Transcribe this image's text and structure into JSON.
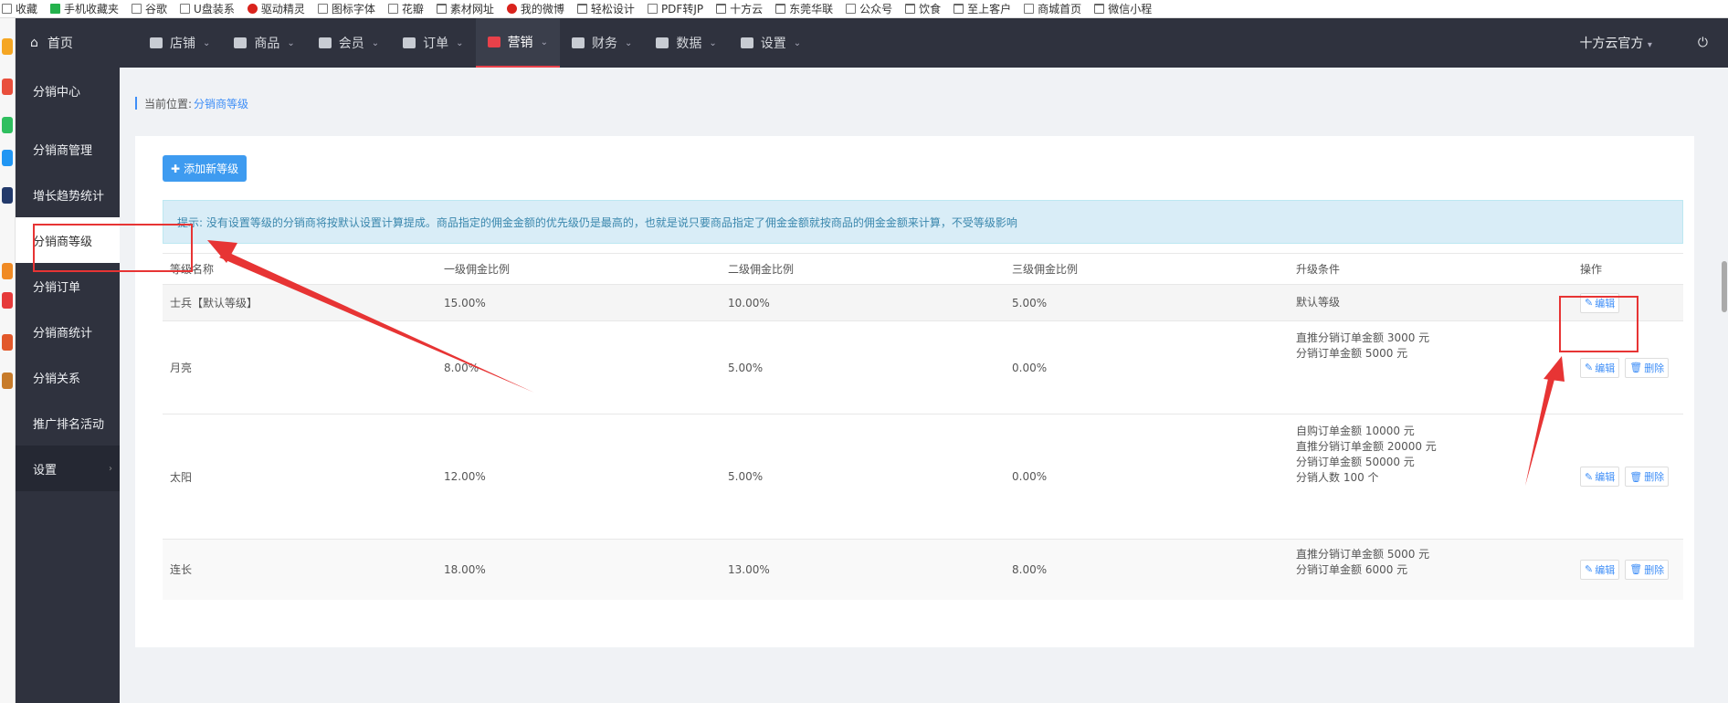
{
  "bookmarks": [
    "收藏",
    "手机收藏夹",
    "谷歌",
    "U盘装系",
    "驱动精灵",
    "图标字体",
    "花瓣",
    "素材网址",
    "我的微博",
    "轻松设计",
    "PDF转JP",
    "十方云",
    "东莞华联",
    "公众号",
    "饮食",
    "至上客户",
    "商城首页",
    "微信小程"
  ],
  "nav": {
    "home": "首页",
    "items": [
      "店铺",
      "商品",
      "会员",
      "订单",
      "营销",
      "财务",
      "数据",
      "设置"
    ],
    "active": "营销",
    "account": "十方云官方"
  },
  "sidebar": {
    "items": [
      "分销中心",
      "分销商管理",
      "增长趋势统计",
      "分销商等级",
      "分销订单",
      "分销商统计",
      "分销关系",
      "推广排名活动",
      "设置"
    ],
    "selected": "分销商等级"
  },
  "breadcrumb": {
    "label": "当前位置:",
    "current": "分销商等级"
  },
  "add_button": "添加新等级",
  "tip": "提示: 没有设置等级的分销商将按默认设置计算提成。商品指定的佣金金额的优先级仍是最高的，也就是说只要商品指定了佣金金额就按商品的佣金金额来计算，不受等级影响",
  "table": {
    "headers": [
      "等级名称",
      "一级佣金比例",
      "二级佣金比例",
      "三级佣金比例",
      "升级条件",
      "操作"
    ],
    "rows": [
      {
        "name": "士兵【默认等级】",
        "c1": "15.00%",
        "c2": "10.00%",
        "c3": "5.00%",
        "conditions": [
          "默认等级"
        ],
        "ops": [
          "编辑"
        ]
      },
      {
        "name": "月亮",
        "c1": "8.00%",
        "c2": "5.00%",
        "c3": "0.00%",
        "conditions": [
          "直推分销订单金额 3000 元",
          "分销订单金额 5000 元"
        ],
        "ops": [
          "编辑",
          "删除"
        ]
      },
      {
        "name": "太阳",
        "c1": "12.00%",
        "c2": "5.00%",
        "c3": "0.00%",
        "conditions": [
          "自购订单金额 10000 元",
          "直推分销订单金额 20000 元",
          "分销订单金额 50000 元",
          "分销人数 100 个"
        ],
        "ops": [
          "编辑",
          "删除"
        ]
      },
      {
        "name": "连长",
        "c1": "18.00%",
        "c2": "13.00%",
        "c3": "8.00%",
        "conditions": [
          "直推分销订单金额 5000 元",
          "分销订单金额 6000 元"
        ],
        "ops": [
          "编辑",
          "删除"
        ]
      }
    ]
  },
  "colors": {
    "nav_bg": "#2f323e",
    "accent": "#3e8ef7",
    "active_red": "#e8414a",
    "annotation_red": "#e73434"
  }
}
